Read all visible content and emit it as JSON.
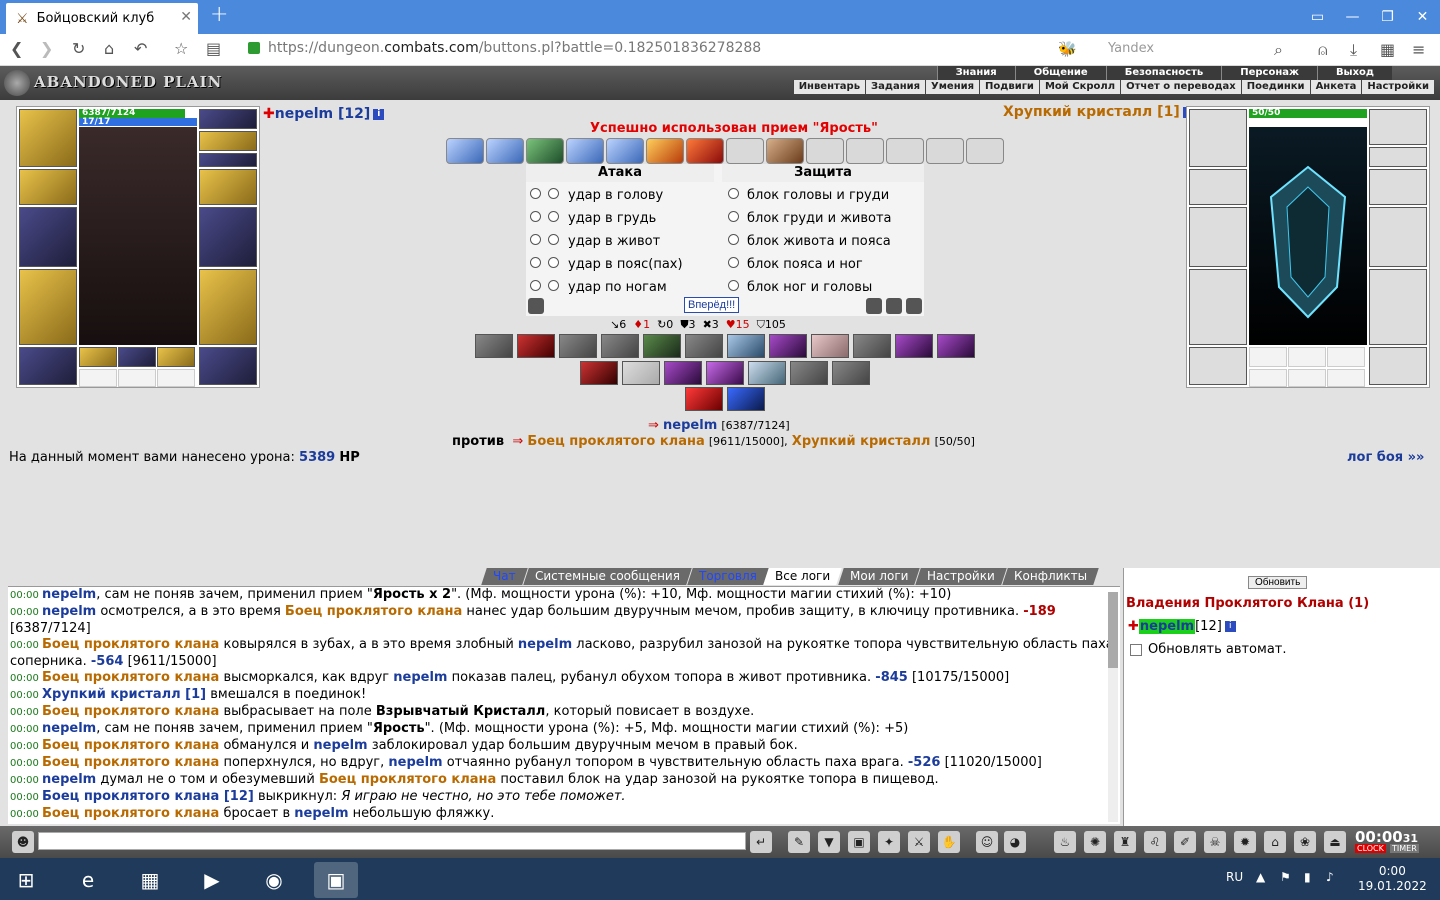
{
  "browser": {
    "tab_title": "Бойцовский клуб",
    "tab_close": "✕",
    "new_tab": "+",
    "url_prefix": "https://dungeon.",
    "url_host": "combats.com",
    "url_path": "/buttons.pl?battle=0.182501836278288",
    "search_placeholder": "Yandex"
  },
  "game": {
    "logo_text": "ABANDONED PLAIN",
    "menu_top": [
      "Знания",
      "Общение",
      "Безопасность",
      "Персонаж",
      "Выход"
    ],
    "menu_bottom": [
      "Инвентарь",
      "Задания",
      "Умения",
      "Подвиги",
      "Мой Скролл",
      "Отчет о переводах",
      "Поединки",
      "Анкета",
      "Настройки"
    ]
  },
  "player": {
    "name": "nepelm [12]",
    "hp_text": "6387/7124",
    "hp_fraction": 0.8966,
    "mp_text": "17/17",
    "mp_fraction": 1.0
  },
  "opponent": {
    "name": "Хрупкий кристалл [1]",
    "hp_text": "50/50",
    "hp_fraction": 1.0
  },
  "combat": {
    "message": "Успешно использован прием \"Ярость\"",
    "attack_header": "Атака",
    "defense_header": "Защита",
    "attacks": [
      "удар в голову",
      "удар в грудь",
      "удар в живот",
      "удар в пояс(пах)",
      "удар по ногам"
    ],
    "defenses": [
      "блок головы и груди",
      "блок груди и живота",
      "блок живота и пояса",
      "блок пояса и ног",
      "блок ног и головы"
    ],
    "go_button": "Вперёд!!!",
    "stats": [
      "↘6",
      "♦1",
      "↻0",
      "⛊3",
      "✖3",
      "♥15",
      "⛉105"
    ],
    "player_line_name": "nepelm",
    "player_line_hp": "[6387/7124]",
    "vs_label": "против",
    "enemy1_name": "Боец проклятого клана",
    "enemy1_hp": "[9611/15000],",
    "enemy2_name": "Хрупкий кристалл",
    "enemy2_hp": "[50/50]",
    "damage_prefix": "На данный момент вами нанесено урона:",
    "damage_value": "5389",
    "damage_unit": "HP",
    "log_link": "лог боя »»"
  },
  "chat": {
    "tabs": [
      "Чат",
      "Системные сообщения",
      "Торговля",
      "Все логи",
      "Мои логи",
      "Настройки",
      "Конфликты"
    ],
    "lines": [
      {
        "time": "00:00",
        "html": "<span class=\"navy\">nepelm</span>, сам не поняв зачем, применил прием \"<b>Ярость x 2</b>\". (Мф. мощности урона (%): +10, Мф. мощности магии стихий (%): +10)"
      },
      {
        "time": "00:00",
        "html": "<span class=\"navy\">nepelm</span> осмотрелся, а в это время <span class=\"brown\">Боец проклятого клана</span> нанес удар большим двуручным мечом, пробив защиту, в ключицу противника. <span class=\"redn\">-189</span> [6387/7124]"
      },
      {
        "time": "00:00",
        "html": "<span class=\"brown\">Боец проклятого клана</span> ковырялся в зубах, а в это время злобный <span class=\"navy\">nepelm</span> ласково, разрубил занозой на рукоятке топора чувствительную область паха соперника. <span class=\"dmgval\">-564</span> [9611/15000]"
      },
      {
        "time": "00:00",
        "html": "<span class=\"brown\">Боец проклятого клана</span> высморкался, как вдруг <span class=\"navy\">nepelm</span> показав палец, рубанул обухом топора в живот противника. <span class=\"dmgval\">-845</span> [10175/15000]"
      },
      {
        "time": "00:00",
        "html": "<span class=\"navy\">Хрупкий кристалл [1]</span> вмешался в поединок!"
      },
      {
        "time": "00:00",
        "html": "<span class=\"brown\">Боец проклятого клана</span> выбрасывает на поле <b>Взрывчатый Кристалл</b>, который повисает в воздухе."
      },
      {
        "time": "00:00",
        "html": "<span class=\"navy\">nepelm</span>, сам не поняв зачем, применил прием \"<b>Ярость</b>\". (Мф. мощности урона (%): +5, Мф. мощности магии стихий (%): +5)"
      },
      {
        "time": "00:00",
        "html": "<span class=\"brown\">Боец проклятого клана</span> обманулся и <span class=\"navy\">nepelm</span> заблокировал удар большим двуручным мечом в правый бок."
      },
      {
        "time": "00:00",
        "html": "<span class=\"brown\">Боец проклятого клана</span> поперхнулся, но вдруг, <span class=\"navy\">nepelm</span> отчаянно рубанул топором в чувствительную область паха врага. <span class=\"dmgval\">-526</span> [11020/15000]"
      },
      {
        "time": "00:00",
        "html": "<span class=\"navy\">nepelm</span> думал не о том и обезумевший <span class=\"brown\">Боец проклятого клана</span> поставил блок на удар занозой на рукоятке топора в пищевод."
      },
      {
        "time": "00:00",
        "html": "<span class=\"navy\">Боец проклятого клана [12]</span> выкрикнул: <i>Я играю не честно, но это тебе поможет.</i>"
      },
      {
        "time": "00:00",
        "html": "<span class=\"brown\">Боец проклятого клана</span> бросает в <span class=\"navy\">nepelm</span> небольшую фляжку."
      }
    ]
  },
  "side": {
    "refresh_button": "Обновить",
    "clan_title": "Владения Проклятого Клана (1)",
    "member_name": "nepelm",
    "member_level": "[12]",
    "auto_refresh": "Обновлять автомат."
  },
  "toolbar": {
    "clock": "00:00",
    "clock_sec": "31",
    "clock_label": "CLOCK",
    "timer_label": "TIMER"
  },
  "taskbar": {
    "lang": "RU",
    "time": "0:00",
    "date": "19.01.2022"
  },
  "colors": {
    "accent": "#4a89dc",
    "hp": "#1fa21f",
    "mana": "#2f6fe0",
    "alert": "#e30000"
  }
}
